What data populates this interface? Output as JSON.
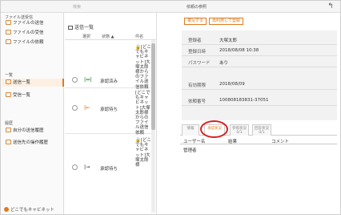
{
  "topbar": {
    "left_label": "検索",
    "right_label": "依頼の参照",
    "back_icon": "↰"
  },
  "sidebar": {
    "section1": "ファイル送受信",
    "items1": [
      {
        "label": "ファイルの送信"
      },
      {
        "label": "ファイルの受信"
      },
      {
        "label": "ファイルの依頼"
      }
    ],
    "section2": "一覧",
    "items2": [
      {
        "label": "送信一覧"
      },
      {
        "label": "受信一覧"
      }
    ],
    "section3": "履歴",
    "items3": [
      {
        "label": "自分の送信履歴"
      },
      {
        "label": "送信先の操作履歴"
      }
    ],
    "footer": "どこでもキャビネット"
  },
  "list": {
    "title": "送信一覧",
    "headers": {
      "select": "選択",
      "status": "状態 ▲",
      "subject": "件名"
    },
    "rows": [
      {
        "arrow": "|↔|",
        "arrow_color": "#2e8b3a",
        "status": "承認済み",
        "subject": "🔒[どこでもキャビネット]大塚太郎様からのファイル送信依頼"
      },
      {
        "arrow": "|←",
        "arrow_color": "#e07a1f",
        "status": "承認待ち",
        "subject": "[どこでもキャビネット]大塚太郎様からのファイル送信依頼"
      },
      {
        "arrow": "|→",
        "arrow_color": "#555555",
        "status": "承認待ち",
        "subject": "🔒[どこでもキャビネット]大塚太郎様"
      }
    ]
  },
  "detail": {
    "buttons": {
      "copy": "複写する",
      "reuse": "再利用して登録"
    },
    "info": [
      {
        "k": "登録者",
        "v": "大塚太郎"
      },
      {
        "k": "登録日時",
        "v": "2018/08/08 10:38"
      },
      {
        "k": "パスワード",
        "v": "あり"
      },
      {
        "k": "有効期限",
        "v": "2018/08/09"
      },
      {
        "k": "依頼番号",
        "v": "100808183831-37051"
      }
    ],
    "tabs": [
      "情報",
      "承認状況",
      "参照状況\n0/1",
      "回答状況\n0/1"
    ],
    "table": {
      "headers": {
        "user": "ユーザー名",
        "result": "結果",
        "comment": "コメント"
      },
      "row": {
        "user": "管理者",
        "result": "",
        "comment": ""
      }
    }
  }
}
